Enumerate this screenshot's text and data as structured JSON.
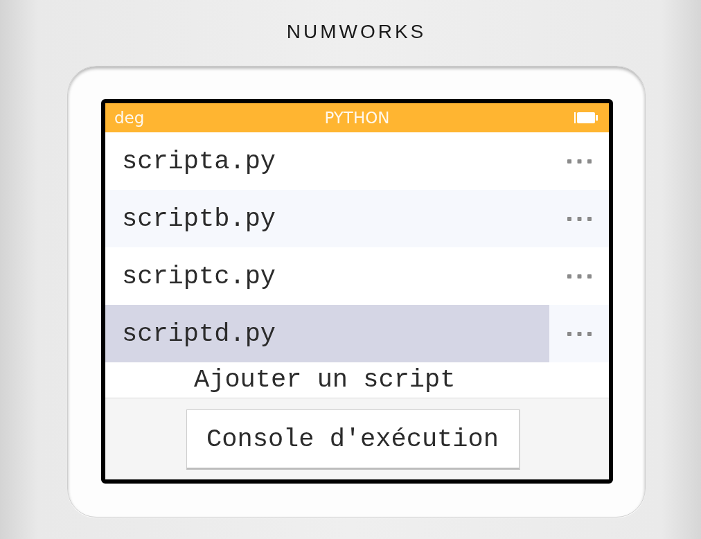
{
  "brand": "NUMWORKS",
  "status_bar": {
    "angle_unit": "deg",
    "title": "PYTHON"
  },
  "scripts": [
    {
      "name": "scripta.py",
      "selected": false
    },
    {
      "name": "scriptb.py",
      "selected": false
    },
    {
      "name": "scriptc.py",
      "selected": false
    },
    {
      "name": "scriptd.py",
      "selected": true
    }
  ],
  "add_script": "Ajouter un script",
  "console_button": "Console d'exécution"
}
